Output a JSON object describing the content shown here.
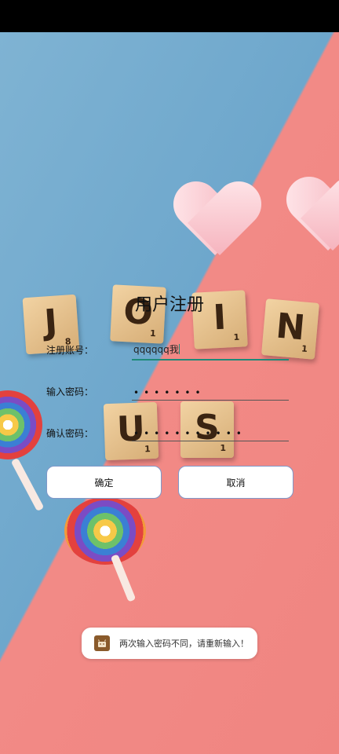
{
  "page": {
    "title": "用户注册"
  },
  "form": {
    "account_label": "注册账号：",
    "account_value": "qqqqqq我",
    "password_label": "输入密码：",
    "password_value": "•••••••",
    "confirm_label": "确认密码：",
    "confirm_value": "•••••••••••"
  },
  "buttons": {
    "confirm": "确定",
    "cancel": "取消"
  },
  "toast": {
    "message": "两次输入密码不同，请重新输入！",
    "icon": "android-app-icon"
  },
  "background": {
    "tiles": [
      {
        "letter": "J",
        "value": "8"
      },
      {
        "letter": "O",
        "value": "1"
      },
      {
        "letter": "I",
        "value": "1"
      },
      {
        "letter": "N",
        "value": "1"
      },
      {
        "letter": "U",
        "value": "1"
      },
      {
        "letter": "S",
        "value": "1"
      }
    ]
  },
  "colors": {
    "accent": "#1f8a79",
    "bg_blue": "#7fb3d3",
    "bg_pink": "#f28a86",
    "button_border": "#7f98c9"
  }
}
